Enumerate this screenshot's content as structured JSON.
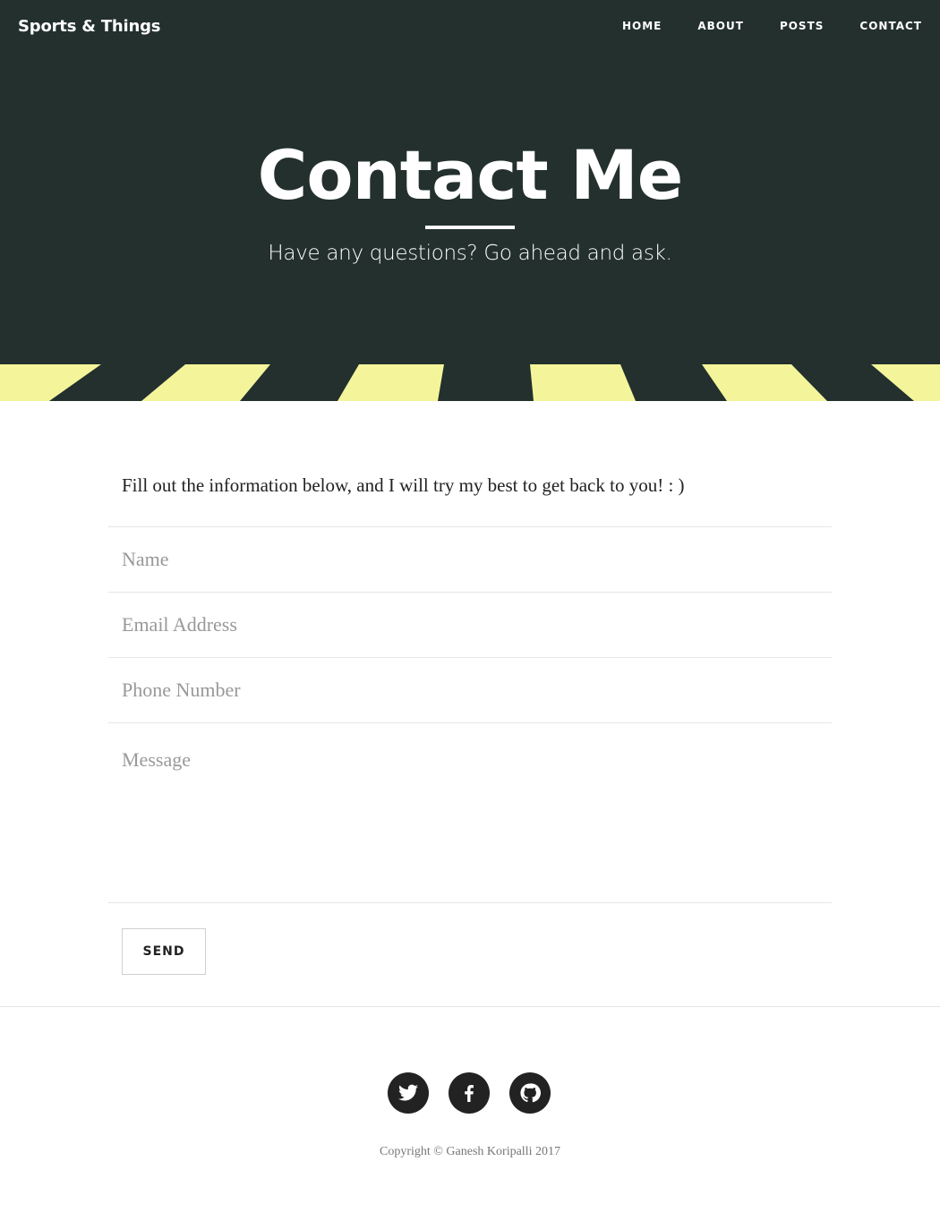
{
  "header": {
    "brand": "Sports & Things",
    "nav": [
      "HOME",
      "ABOUT",
      "POSTS",
      "CONTACT"
    ]
  },
  "hero": {
    "title": "Contact Me",
    "subtitle": "Have any questions? Go ahead and ask."
  },
  "form": {
    "intro": "Fill out the information below, and I will try my best to get back to you! : )",
    "name_placeholder": "Name",
    "email_placeholder": "Email Address",
    "phone_placeholder": "Phone Number",
    "message_placeholder": "Message",
    "send_label": "SEND"
  },
  "footer": {
    "social_icons": [
      "twitter-icon",
      "facebook-icon",
      "github-icon"
    ],
    "copyright": "Copyright © Ganesh Koripalli 2017"
  },
  "colors": {
    "hero_bg": "#23302e",
    "stripe": "#f4f59b",
    "icon_circle": "#222222"
  }
}
